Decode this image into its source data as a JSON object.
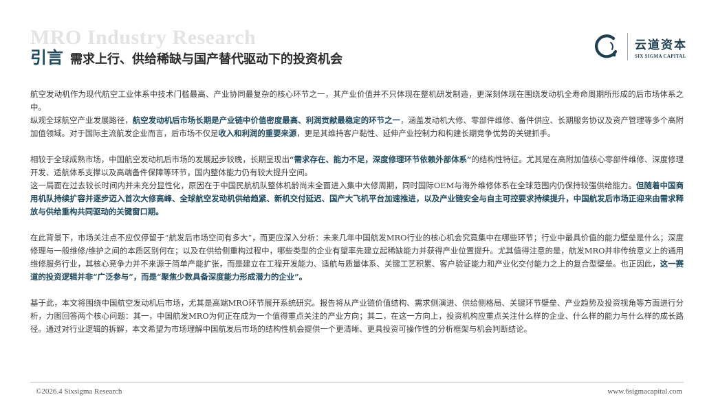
{
  "watermark_title": "MRO Industry Research",
  "heading": {
    "tag": "引言",
    "subtitle": "需求上行、供给稀缺与国产替代驱动下的投资机会"
  },
  "logo": {
    "chinese": "云道资本",
    "english": "SIX SIGMA CAPITAL",
    "mark_icon": "circular-swirl-icon",
    "color": "#1e3f50"
  },
  "paragraphs": [
    {
      "gap": false,
      "runs": [
        {
          "t": "航空发动机作为现代航空工业体系中技术门槛最高、产业协同最复杂的核心环节之一，其产业价值并不只体现在整机研发制造，更深刻体现在围绕发动机全寿命周期所形成的后市场体系之中。",
          "b": false
        }
      ]
    },
    {
      "gap": false,
      "runs": [
        {
          "t": "纵观全球航空产业发展路径，",
          "b": false
        },
        {
          "t": "航空发动机后市场长期是产业链中价值密度最高、利润贡献最稳定的环节之一",
          "b": true
        },
        {
          "t": "，涵盖发动机大修、零部件维修、备件供应、长期服务协议及资产管理等多个高附加值领域。对于国际主流航发企业而言，后市场不仅是",
          "b": false
        },
        {
          "t": "收入和利润的重要来源",
          "b": true
        },
        {
          "t": "，更是其维持客户黏性、延伸产业控制力和构建长期竞争优势的关键抓手。",
          "b": false
        }
      ]
    },
    {
      "gap": true,
      "runs": [
        {
          "t": "相较于全球成熟市场，中国航空发动机后市场的发展起步较晚，长期呈现出",
          "b": false
        },
        {
          "t": "“需求存在、能力不足，深度修理环节依赖外部体系”",
          "b": true
        },
        {
          "t": "的结构性特征。尤其是在高附加值核心零部件维修、深度修理开发、适航体系支撑以及高端备件保障等环节，国内整体能力仍有较大提升空间。",
          "b": false
        }
      ]
    },
    {
      "gap": false,
      "runs": [
        {
          "t": "这一局面在过去较长时间内并未充分显性化，原因在于中国民航机队整体机龄尚未全面进入集中大修周期，同时国际OEM与海外维修体系在全球范围内仍保持较强供给能力。",
          "b": false
        },
        {
          "t": "但随着中国商用机队持续扩容并逐步迈入首次大修高峰、全球航空发动机供给趋紧、新机交付延迟、国产大飞机平台加速推进，以及产业链安全与自主可控要求持续提升，中国航发后市场正迎来由需求释放与供给重构共同驱动的关键窗口期。",
          "b": true
        }
      ]
    },
    {
      "gap": true,
      "runs": [
        {
          "t": "在此背景下，市场关注点不应仅停留于“航发后市场空间有多大”，而更应深入分析：未来几年中国航发MRO行业的核心机会究竟集中在哪些环节；行业中最具价值的能力壁垒是什么；深度修理与一般维修/维护之间的本质区别何在；以及在供给侧重构过程中，哪些类型的企业有望率先建立起稀缺能力并获得产业位置提升。尤其值得注意的是，航发MRO并非传统意义上的通用维修服务行业，其核心竞争力并不来源于简单产能扩张，而是建立在工程开发能力、适航与质量体系、关键工艺积累、客户验证能力和产业化交付能力之上的复合型壁垒。也正因此，",
          "b": false
        },
        {
          "t": "这一赛道的投资逻辑并非“广泛参与”，而是“聚焦少数具备深度能力形成潜力的企业”。",
          "b": true
        }
      ]
    },
    {
      "gap": true,
      "runs": [
        {
          "t": "基于此，本文将围绕中国航空发动机后市场，尤其是高端MRO环节展开系统研究。报告将从产业链价值结构、需求侧演进、供给侧格局、关键环节壁垒、产业趋势及投资视角等方面进行分析，力图回答两个核心问题：其一，中国航发MRO为何正在成为一个值得重点关注的产业方向；其二，在这一方向上，投资机构应重点关注什么样的企业、什么样的能力与什么样的成长路径。通过对行业逻辑的拆解，本文希望为市场理解中国航发后市场的结构性机会提供一个更清晰、更具投资可操作性的分析框架与机会判断结论。",
          "b": false
        }
      ]
    }
  ],
  "footer": {
    "copyright": "©2026.4 Sixsigma Research",
    "website": "www.6sigmacapital.com"
  },
  "colors": {
    "accent": "#1f4a5e",
    "body_text": "#3a3a3a",
    "watermark": "#e3e3e3"
  }
}
